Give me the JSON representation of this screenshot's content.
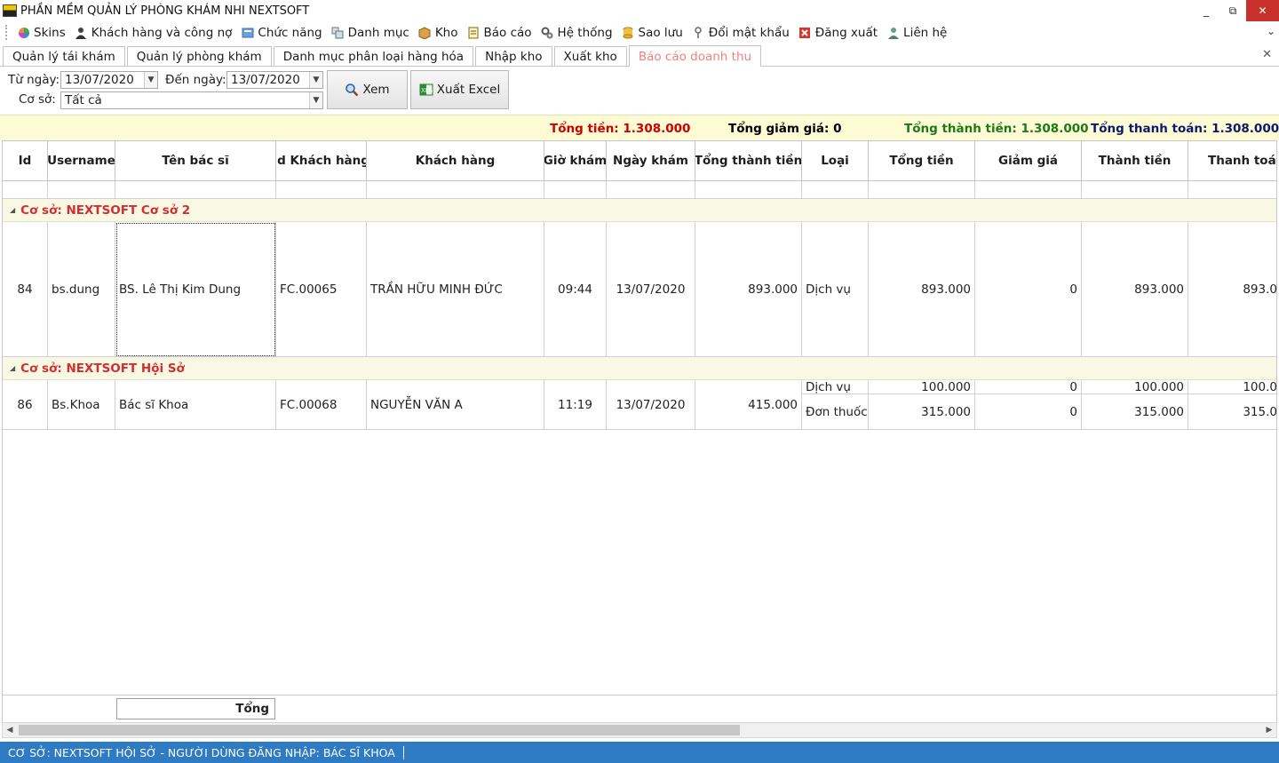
{
  "window": {
    "title": "PHẦN MỀM QUẢN LÝ PHÒNG KHÁM NHI NEXTSOFT",
    "minimize_label": "_",
    "restore_label": "⧉",
    "close_label": "✕"
  },
  "menu": {
    "items": [
      {
        "label": "Skins",
        "icon": "palette-icon"
      },
      {
        "label": "Khách hàng và công nợ",
        "icon": "user-icon"
      },
      {
        "label": "Chức năng",
        "icon": "function-icon"
      },
      {
        "label": "Danh mục",
        "icon": "catalog-icon"
      },
      {
        "label": "Kho",
        "icon": "box-icon"
      },
      {
        "label": "Báo cáo",
        "icon": "report-icon"
      },
      {
        "label": "Hệ thống",
        "icon": "gear-icon"
      },
      {
        "label": "Sao lưu",
        "icon": "database-icon"
      },
      {
        "label": "Đổi mật khẩu",
        "icon": "key-icon"
      },
      {
        "label": "Đăng xuất",
        "icon": "logout-icon"
      },
      {
        "label": "Liên hệ",
        "icon": "contact-icon"
      }
    ],
    "more_glyph": "⌄"
  },
  "tabs": [
    {
      "label": "Quản lý tái khám",
      "active": false
    },
    {
      "label": "Quản lý phòng khám",
      "active": false
    },
    {
      "label": "Danh mục phân loại hàng hóa",
      "active": false
    },
    {
      "label": "Nhập kho",
      "active": false
    },
    {
      "label": "Xuất kho",
      "active": false
    },
    {
      "label": "Báo cáo doanh thu",
      "active": true
    }
  ],
  "tabs_close": "✕",
  "filter": {
    "from_label": "Từ ngày:",
    "from_value": "13/07/2020",
    "to_label": "Đến ngày:",
    "to_value": "13/07/2020",
    "branch_label": "Cơ sở:",
    "branch_value": "Tất cả",
    "view_button": "Xem",
    "export_button": "Xuất Excel"
  },
  "summary": {
    "total": "Tổng tiền: 1.308.000",
    "discount": "Tổng giảm giá: 0",
    "net": "Tổng thành tiền: 1.308.000",
    "paid": "Tổng thanh toán: 1.308.000",
    "colors": {
      "total": "#cc0000",
      "discount": "#000000",
      "net": "#1a7a1a",
      "paid": "#0a1a6e"
    }
  },
  "grid": {
    "columns": [
      "Id",
      "Username",
      "Tên bác sĩ",
      "Id Khách hàng",
      "Khách hàng",
      "Giờ khám",
      "Ngày khám",
      "Tổng thành tiền",
      "Loại",
      "Tổng tiền",
      "Giảm giá",
      "Thành tiền",
      "Thanh toán"
    ],
    "groups": [
      {
        "label": "Cơ sở: NEXTSOFT Cơ sở 2",
        "rows": [
          {
            "id": "84",
            "username": "bs.dung",
            "doctor": "BS. Lê Thị Kim Dung",
            "customer_id": "FC.00065",
            "customer": "TRẦN HỮU MINH ĐỨC",
            "time": "09:44",
            "date": "13/07/2020",
            "grand_total": "893.000",
            "items": [
              {
                "type": "Dịch vụ",
                "total": "893.000",
                "discount": "0",
                "net": "893.000",
                "paid": "893.0"
              }
            ]
          }
        ]
      },
      {
        "label": "Cơ sở: NEXTSOFT Hội Sở",
        "rows": [
          {
            "id": "86",
            "username": "Bs.Khoa",
            "doctor": "Bác sĩ Khoa",
            "customer_id": "FC.00068",
            "customer": "NGUYỄN VĂN A",
            "time": "11:19",
            "date": "13/07/2020",
            "grand_total": "415.000",
            "items": [
              {
                "type": "Dịch vụ",
                "total": "100.000",
                "discount": "0",
                "net": "100.000",
                "paid": "100.0"
              },
              {
                "type": "Đơn thuốc",
                "total": "315.000",
                "discount": "0",
                "net": "315.000",
                "paid": "315.0"
              }
            ]
          }
        ]
      }
    ],
    "footer_total_label": "Tổng"
  },
  "status": {
    "text": "CƠ SỞ: NEXTSOFT HỘI SỞ - NGƯỜI DÙNG ĐĂNG NHẬP: BÁC SĨ KHOA"
  }
}
